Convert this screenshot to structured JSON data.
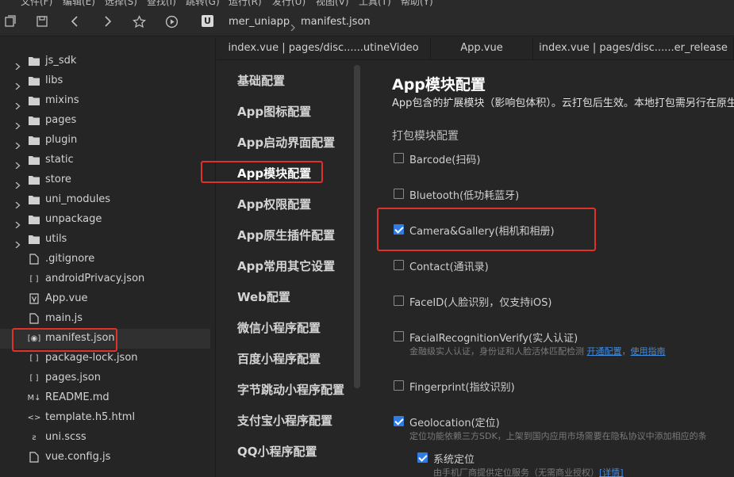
{
  "menu": [
    "文件(F)",
    "编辑(E)",
    "选择(S)",
    "查找(I)",
    "跳转(G)",
    "运行(R)",
    "发行(U)",
    "视图(V)",
    "工具(T)",
    "帮助(Y)"
  ],
  "breadcrumb": {
    "project": "mer_uniapp",
    "file": "manifest.json"
  },
  "file_tree": [
    {
      "name": "js_sdk",
      "type": "folder"
    },
    {
      "name": "libs",
      "type": "folder"
    },
    {
      "name": "mixins",
      "type": "folder"
    },
    {
      "name": "pages",
      "type": "folder"
    },
    {
      "name": "plugin",
      "type": "folder"
    },
    {
      "name": "static",
      "type": "folder"
    },
    {
      "name": "store",
      "type": "folder"
    },
    {
      "name": "uni_modules",
      "type": "folder"
    },
    {
      "name": "unpackage",
      "type": "folder"
    },
    {
      "name": "utils",
      "type": "folder"
    },
    {
      "name": ".gitignore",
      "type": "file"
    },
    {
      "name": "androidPrivacy.json",
      "type": "json"
    },
    {
      "name": "App.vue",
      "type": "vue"
    },
    {
      "name": "main.js",
      "type": "js"
    },
    {
      "name": "manifest.json",
      "type": "manifest",
      "selected": true
    },
    {
      "name": "package-lock.json",
      "type": "json"
    },
    {
      "name": "pages.json",
      "type": "json"
    },
    {
      "name": "README.md",
      "type": "md"
    },
    {
      "name": "template.h5.html",
      "type": "html"
    },
    {
      "name": "uni.scss",
      "type": "scss"
    },
    {
      "name": "vue.config.js",
      "type": "js"
    }
  ],
  "tabs": [
    {
      "label": "index.vue | pages/disc......utineVideo"
    },
    {
      "label": "App.vue"
    },
    {
      "label": "index.vue | pages/disc......er_release"
    }
  ],
  "settings_nav": [
    {
      "label": "基础配置"
    },
    {
      "label": "App图标配置"
    },
    {
      "label": "App启动界面配置"
    },
    {
      "label": "App模块配置",
      "active": true
    },
    {
      "label": "App权限配置"
    },
    {
      "label": "App原生插件配置"
    },
    {
      "label": "App常用其它设置"
    },
    {
      "label": "Web配置"
    },
    {
      "label": "微信小程序配置"
    },
    {
      "label": "百度小程序配置"
    },
    {
      "label": "字节跳动小程序配置"
    },
    {
      "label": "支付宝小程序配置"
    },
    {
      "label": "QQ小程序配置"
    }
  ],
  "main": {
    "title": "App模块配置",
    "description": "App包含的扩展模块（影响包体积）。云打包后生效。本地打包需另行在原生",
    "section_label": "打包模块配置",
    "options": [
      {
        "label": "Barcode(扫码)",
        "checked": false
      },
      {
        "label": "Bluetooth(低功耗蓝牙)",
        "checked": false
      },
      {
        "label": "Camera&Gallery(相机和相册)",
        "checked": true
      },
      {
        "label": "Contact(通讯录)",
        "checked": false
      },
      {
        "label": "FaceID(人脸识别，仅支持iOS)",
        "checked": false
      },
      {
        "label": "FacialRecognitionVerify(实人认证)",
        "checked": false
      },
      {
        "label": "Fingerprint(指纹识别)",
        "checked": false
      },
      {
        "label": "Geolocation(定位)",
        "checked": true
      }
    ],
    "facial_hint": {
      "text": "金融级实人认证，身份证和人脸活体匹配检测 ",
      "link1": "开通配置",
      "sep": "，",
      "link2": "使用指南"
    },
    "geo_hint": "定位功能依赖三方SDK，上架到国内应用市场需要在隐私协议中添加相应的条",
    "sub_option": {
      "label": "系统定位",
      "checked": true
    },
    "sub_hint": {
      "text": "由手机厂商提供定位服务（无需商业授权）",
      "link": "[详情]"
    }
  }
}
